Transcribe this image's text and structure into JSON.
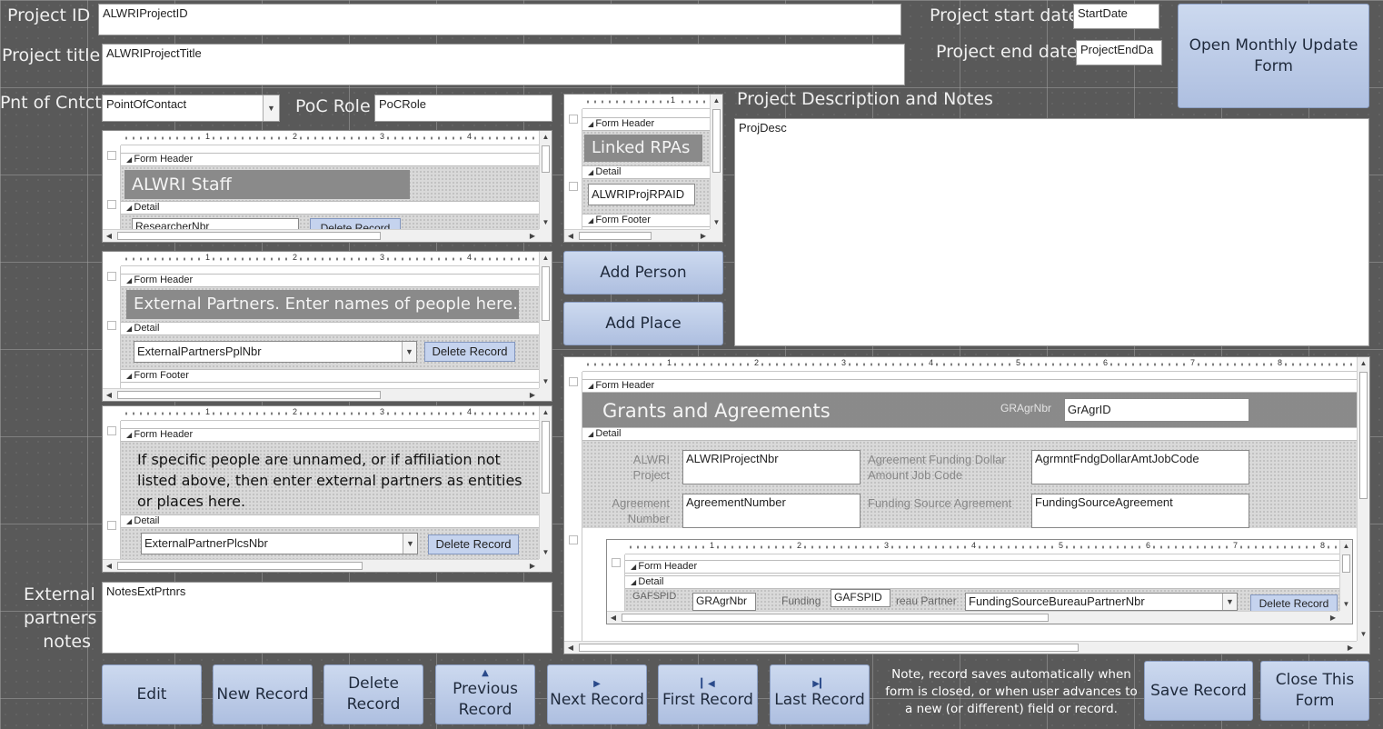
{
  "labels": {
    "project_id": "Project ID",
    "project_title": "Project title",
    "point_of_contact": "Pnt of Cntct",
    "poc_role": "PoC Role",
    "project_start_date": "Project start date",
    "project_end_date": "Project end date",
    "project_description": "Project Description and Notes",
    "external_partners_notes_1": "External",
    "external_partners_notes_2": "partners",
    "external_partners_notes_3": "notes"
  },
  "fields": {
    "project_id": "ALWRIProjectID",
    "project_title": "ALWRIProjectTitle",
    "point_of_contact": "PointOfContact",
    "poc_role": "PoCRole",
    "start_date": "StartDate",
    "end_date": "ProjectEndDa",
    "project_description": "ProjDesc",
    "external_partners_notes": "NotesExtPrtnrs"
  },
  "subforms": {
    "section_form_header": "Form Header",
    "section_detail": "Detail",
    "section_form_footer": "Form Footer",
    "staff": {
      "title": "ALWRI Staff",
      "field": "ResearcherNbr",
      "button": "Delete Record"
    },
    "rpas": {
      "title": "Linked RPAs",
      "field": "ALWRIProjRPAID"
    },
    "partners": {
      "title": "External Partners. Enter names of people here.",
      "field": "ExternalPartnersPplNbr",
      "button": "Delete Record"
    },
    "places": {
      "title": "If specific people are unnamed, or if affiliation not listed above, then enter external partners as entities or places here.",
      "field": "ExternalPartnerPlcsNbr",
      "button": "Delete Record"
    },
    "grants": {
      "title": "Grants and Agreements",
      "gragr_label": "GRAgrNbr",
      "gragr_field": "GrAgrID",
      "alwri_project_label_1": "ALWRI",
      "alwri_project_label_2": "Project",
      "alwri_project_field": "ALWRIProjectNbr",
      "funding_label_1": "Agreement Funding Dollar",
      "funding_label_2": "Amount Job Code",
      "funding_field": "AgrmntFndgDollarAmtJobCode",
      "agreement_number_label_1": "Agreement",
      "agreement_number_label_2": "Number",
      "agreement_number_field": "AgreementNumber",
      "funding_source_label": "Funding Source Agreement",
      "funding_source_field": "FundingSourceAgreement",
      "inner": {
        "gafspid_label": "GAFSPID",
        "gragr_label": "GRAgrNbr",
        "gragr_field": "GRAgrNbr",
        "funding_label": "Funding",
        "gafspid_field": "GAFSPID",
        "bureau_label": "reau Partner",
        "bureau_field": "FundingSourceBureauPartnerNbr",
        "delete_button": "Delete Record"
      }
    }
  },
  "ruler_ticks": [
    "1",
    "2",
    "3",
    "4",
    "5",
    "6",
    "7",
    "8"
  ],
  "buttons": {
    "open_monthly_1": "Open Monthly Update",
    "open_monthly_2": "Form",
    "add_person": "Add Person",
    "add_place": "Add Place",
    "edit": "Edit",
    "new_record": "New Record",
    "delete_record": "Delete Record",
    "previous_record_1": "Previous",
    "previous_record_2": "Record",
    "next_record": "Next Record",
    "first_record": "First Record",
    "last_record": "Last Record",
    "save_record": "Save Record",
    "close_form_1": "Close This",
    "close_form_2": "Form"
  },
  "note": {
    "line1": "Note, record saves automatically when",
    "line2": "form is closed, or when user advances to",
    "line3": "a new (or different) field or record."
  },
  "icons": {
    "previous": "triangle-up-icon",
    "next": "triangle-right-icon",
    "first": "skip-first-icon",
    "last": "skip-last-icon"
  }
}
